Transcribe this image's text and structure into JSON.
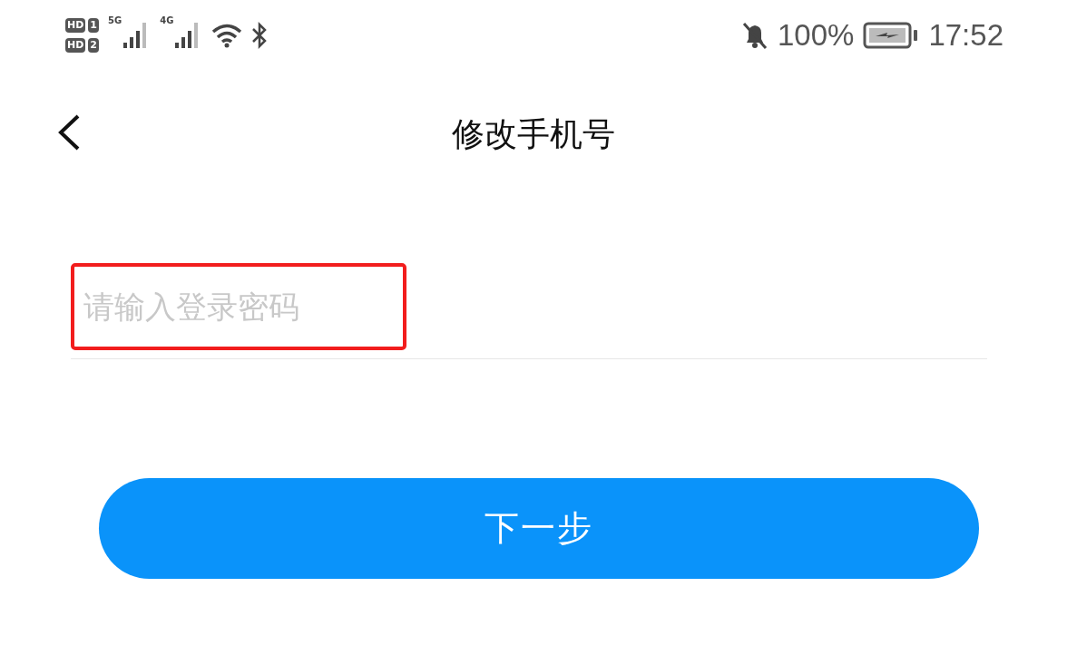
{
  "status_bar": {
    "sim_badges": [
      {
        "label": "HD",
        "slot": "1"
      },
      {
        "label": "HD",
        "slot": "2"
      }
    ],
    "networks": [
      "5G",
      "4G"
    ],
    "battery": "100%",
    "time": "17:52"
  },
  "nav": {
    "title": "修改手机号"
  },
  "password_field": {
    "placeholder": "请输入登录密码",
    "highlighted": true
  },
  "next_button": {
    "label": "下一步"
  }
}
